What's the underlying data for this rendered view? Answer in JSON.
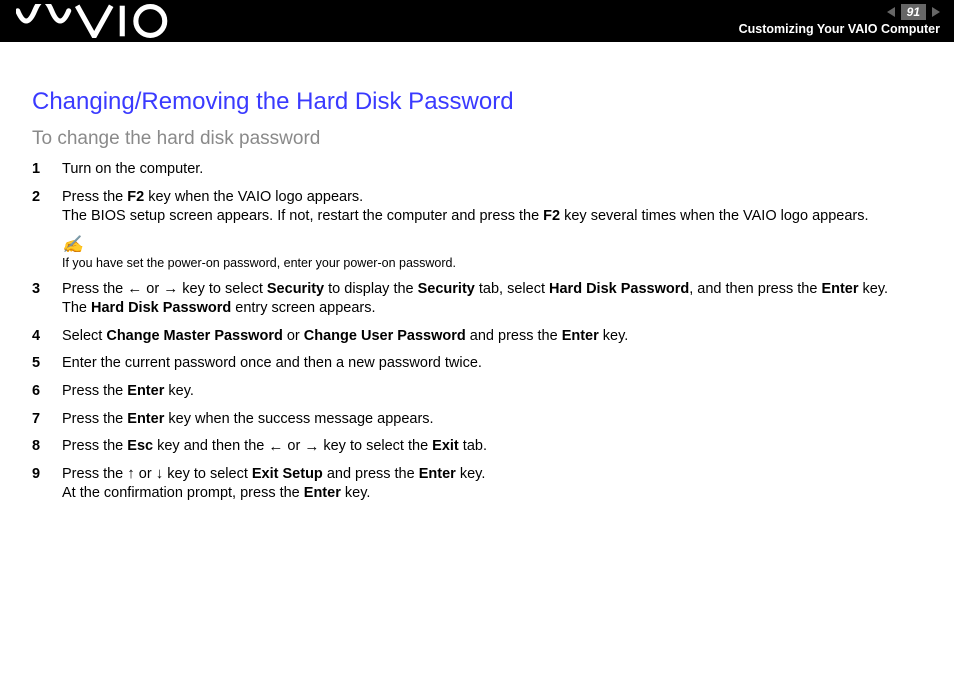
{
  "header": {
    "page_number": "91",
    "section": "Customizing Your VAIO Computer"
  },
  "title": "Changing/Removing the Hard Disk Password",
  "subtitle": "To change the hard disk password",
  "steps": [
    {
      "n": "1",
      "html": "Turn on the computer."
    },
    {
      "n": "2",
      "html": "Press the <b>F2</b> key when the VAIO logo appears.<br>The BIOS setup screen appears. If not, restart the computer and press the <b>F2</b> key several times when the VAIO logo appears."
    },
    {
      "n": "3",
      "html": "Press the <span class=\"arrow\">&#8592;</span> or <span class=\"arrow\">&#8594;</span> key to select <b>Security</b> to display the <b>Security</b> tab, select <b>Hard Disk Password</b>, and then press the <b>Enter</b> key.<br>The <b>Hard Disk Password</b> entry screen appears."
    },
    {
      "n": "4",
      "html": "Select <b>Change Master Password</b> or <b>Change User Password</b> and press the <b>Enter</b> key."
    },
    {
      "n": "5",
      "html": "Enter the current password once and then a new password twice."
    },
    {
      "n": "6",
      "html": "Press the <b>Enter</b> key."
    },
    {
      "n": "7",
      "html": "Press the <b>Enter</b> key when the success message appears."
    },
    {
      "n": "8",
      "html": "Press the <b>Esc</b> key and then the <span class=\"arrow\">&#8592;</span> or <span class=\"arrow\">&#8594;</span> key to select the <b>Exit</b> tab."
    },
    {
      "n": "9",
      "html": "Press the <span class=\"arrow\">&#8593;</span> or <span class=\"arrow\">&#8595;</span> key to select <b>Exit Setup</b> and press the <b>Enter</b> key.<br>At the confirmation prompt, press the <b>Enter</b> key."
    }
  ],
  "note_after_step": 2,
  "note": {
    "icon": "✍",
    "text": "If you have set the power-on password, enter your power-on password."
  }
}
